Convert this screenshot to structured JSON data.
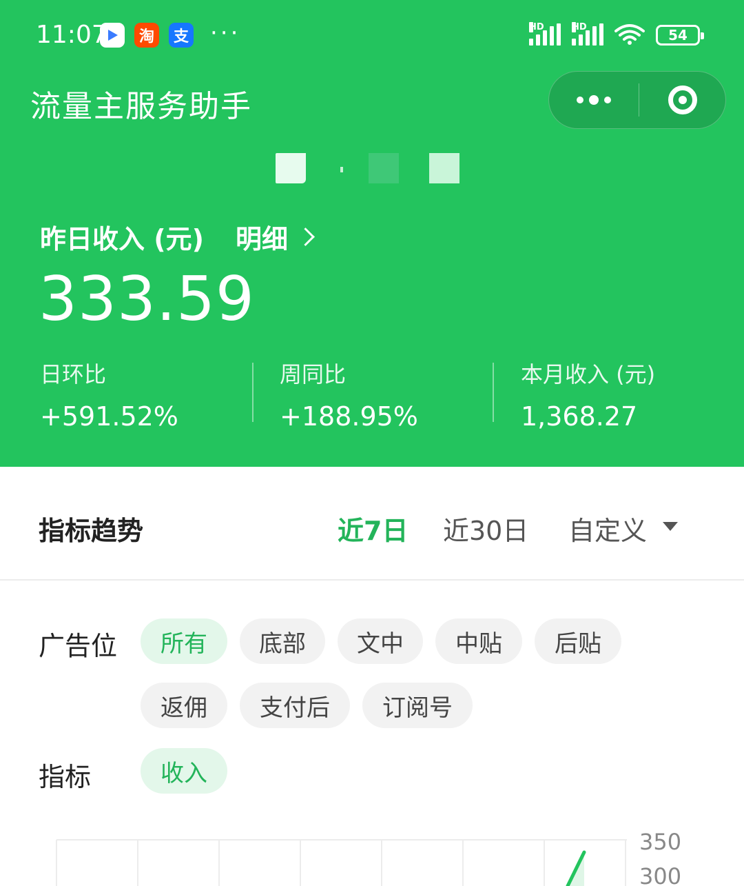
{
  "status_bar": {
    "time": "11:07",
    "apps": [
      "video-app-icon",
      "taobao-app-icon",
      "alipay-app-icon"
    ],
    "taobao_glyph": "淘",
    "alipay_glyph": "支",
    "more": "···",
    "signal_label_1": "HD",
    "signal_label_2": "HD",
    "battery": "54"
  },
  "navbar": {
    "title": "流量主服务助手"
  },
  "summary": {
    "income_label": "昨日收入 (元)",
    "detail_label": "明细",
    "income_value": "333.59",
    "stats": [
      {
        "label": "日环比",
        "value": "+591.52%"
      },
      {
        "label": "周同比",
        "value": "+188.95%"
      },
      {
        "label": "本月收入 (元)",
        "value": "1,368.27"
      }
    ]
  },
  "trend": {
    "title": "指标趋势",
    "ranges": [
      "近7日",
      "近30日",
      "自定义"
    ],
    "active_range": "近7日"
  },
  "filters": {
    "ad_slot_label": "广告位",
    "ad_slots": [
      "所有",
      "底部",
      "文中",
      "中贴",
      "后贴",
      "返佣",
      "支付后",
      "订阅号"
    ],
    "active_ad_slot": "所有",
    "metric_label": "指标",
    "metrics": [
      "收入"
    ],
    "active_metric": "收入"
  },
  "chart_data": {
    "type": "line",
    "ytick_labels": [
      "350",
      "300"
    ],
    "series_color": "#23c45e",
    "grid": true
  },
  "colors": {
    "brand_green": "#23c45e",
    "active_text": "#23b45a",
    "chip_bg": "#f2f2f2",
    "chip_active_bg": "#e3f7ea"
  }
}
